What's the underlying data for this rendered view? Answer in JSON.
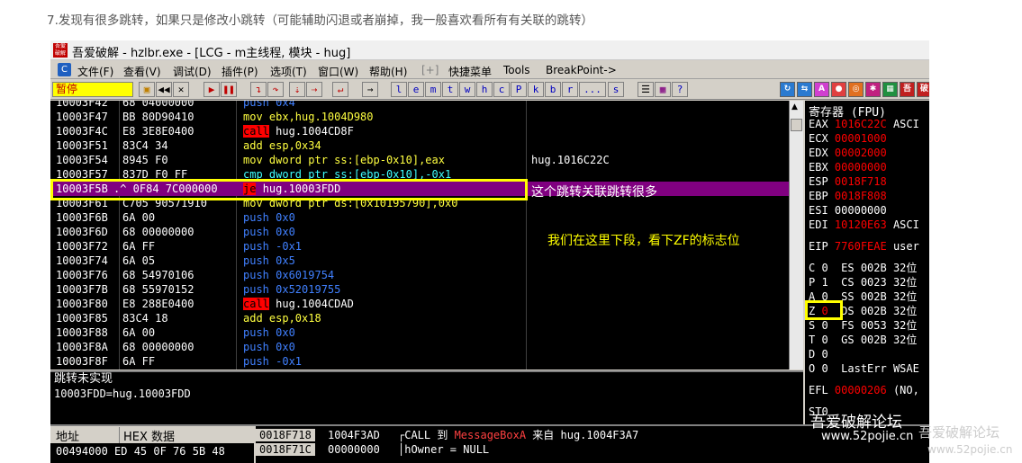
{
  "caption": "7.发现有很多跳转，如果只是修改小跳转（可能辅助闪退或者崩掉，我一般喜欢看所有有关联的跳转）",
  "window": {
    "icon_text": "吾爱\n破解",
    "title": "吾爱破解 - hzlbr.exe - [LCG - m主线程, 模块 - hug]"
  },
  "menu": [
    "文件(F)",
    "查看(V)",
    "调试(D)",
    "插件(P)",
    "选项(T)",
    "窗口(W)",
    "帮助(H)",
    "[+]",
    "快捷菜单",
    "Tools",
    "BreakPoint->"
  ],
  "toolbar": {
    "status": "暂停",
    "letters": [
      "l",
      "e",
      "m",
      "t",
      "w",
      "h",
      "c",
      "P",
      "k",
      "b",
      "r",
      "...",
      "s"
    ]
  },
  "disasm": {
    "rows": [
      {
        "addr": "10003F42",
        "hex": "68 04000000",
        "asm": "push 0x4",
        "comment": ""
      },
      {
        "addr": "10003F47",
        "hex": "BB 80D90410",
        "asm": "mov ebx,hug.1004D980",
        "comment": ""
      },
      {
        "addr": "10003F4C",
        "hex": "E8 3E8E0400",
        "asm": "call hug.1004CD8F",
        "comment": ""
      },
      {
        "addr": "10003F51",
        "hex": "83C4 34",
        "asm": "add esp,0x34",
        "comment": ""
      },
      {
        "addr": "10003F54",
        "hex": "8945 F0",
        "asm": "mov dword ptr ss:[ebp-0x10],eax",
        "comment": "hug.1016C22C"
      },
      {
        "addr": "10003F57",
        "hex": "837D F0 FF",
        "asm": "cmp dword ptr ss:[ebp-0x10],-0x1",
        "comment": ""
      },
      {
        "addr": "10003F5B",
        "hex": ".^ 0F84 7C000000",
        "asm": "je hug.10003FDD",
        "comment": ""
      },
      {
        "addr": "10003F61",
        "hex": "C705 90571910",
        "asm": "mov dword ptr ds:[0x10195790],0x0",
        "comment": ""
      },
      {
        "addr": "10003F6B",
        "hex": "6A 00",
        "asm": "push 0x0",
        "comment": ""
      },
      {
        "addr": "10003F6D",
        "hex": "68 00000000",
        "asm": "push 0x0",
        "comment": ""
      },
      {
        "addr": "10003F72",
        "hex": "6A FF",
        "asm": "push -0x1",
        "comment": ""
      },
      {
        "addr": "10003F74",
        "hex": "6A 05",
        "asm": "push 0x5",
        "comment": ""
      },
      {
        "addr": "10003F76",
        "hex": "68 54970106",
        "asm": "push 0x6019754",
        "comment": ""
      },
      {
        "addr": "10003F7B",
        "hex": "68 55970152",
        "asm": "push 0x52019755",
        "comment": ""
      },
      {
        "addr": "10003F80",
        "hex": "E8 288E0400",
        "asm": "call hug.1004CDAD",
        "comment": ""
      },
      {
        "addr": "10003F85",
        "hex": "83C4 18",
        "asm": "add esp,0x18",
        "comment": ""
      },
      {
        "addr": "10003F88",
        "hex": "6A 00",
        "asm": "push 0x0",
        "comment": ""
      },
      {
        "addr": "10003F8A",
        "hex": "68 00000000",
        "asm": "push 0x0",
        "comment": ""
      },
      {
        "addr": "10003F8F",
        "hex": "6A FF",
        "asm": "push -0x1",
        "comment": ""
      }
    ],
    "note_jump": "这个跳转关联跳转很多",
    "note_bp": "我们在这里下段，看下ZF的标志位"
  },
  "info": {
    "line1": "跳转未实现",
    "line2": "10003FDD=hug.10003FDD"
  },
  "registers": {
    "header": "寄存器 (FPU)",
    "rows": [
      {
        "name": "EAX",
        "value": "1016C22C",
        "extra": "ASCI",
        "red": true
      },
      {
        "name": "ECX",
        "value": "00001000",
        "extra": "",
        "red": true
      },
      {
        "name": "EDX",
        "value": "00002000",
        "extra": "",
        "red": true
      },
      {
        "name": "EBX",
        "value": "00000000",
        "extra": "",
        "red": true
      },
      {
        "name": "ESP",
        "value": "0018F718",
        "extra": "",
        "red": true
      },
      {
        "name": "EBP",
        "value": "0018F808",
        "extra": "",
        "red": true
      },
      {
        "name": "ESI",
        "value": "00000000",
        "extra": "",
        "red": false
      },
      {
        "name": "EDI",
        "value": "10120E63",
        "extra": "ASCI",
        "red": true
      },
      {
        "name": "EIP",
        "value": "7760FEAE",
        "extra": "user",
        "red": true
      }
    ],
    "flags": [
      {
        "flag": "C",
        "val": "0",
        "seg": "ES 002B 32位"
      },
      {
        "flag": "P",
        "val": "1",
        "seg": "CS 0023 32位"
      },
      {
        "flag": "A",
        "val": "0",
        "seg": "SS 002B 32位"
      },
      {
        "flag": "Z",
        "val": "0",
        "seg": "DS 002B 32位"
      },
      {
        "flag": "S",
        "val": "0",
        "seg": "FS 0053 32位"
      },
      {
        "flag": "T",
        "val": "0",
        "seg": "GS 002B 32位"
      },
      {
        "flag": "D",
        "val": "0",
        "seg": ""
      },
      {
        "flag": "O",
        "val": "0",
        "seg": "LastErr WSAE"
      }
    ],
    "efl": {
      "name": "EFL",
      "value": "00000206",
      "extra": "(NO,"
    },
    "st0": "ST0"
  },
  "dump": {
    "col_addr": "地址",
    "col_hex": "HEX 数据",
    "row": "00494000 ED 45 0F 76 5B 48"
  },
  "stack": {
    "rows": [
      {
        "addr": "0018F718",
        "value": "1004F3AD",
        "comment": "┌CALL 到 ",
        "call": "MessageBoxA",
        "tail": " 来自 hug.1004F3A7"
      },
      {
        "addr": "0018F71C",
        "value": "00000000",
        "comment": "│hOwner = NULL",
        "call": "",
        "tail": ""
      }
    ]
  },
  "watermarks": {
    "w1": "吾爱破解论坛",
    "w2": "www.52pojie.cn",
    "w3": "吾爱破解论坛",
    "w4": "www.52pojie.cn"
  }
}
